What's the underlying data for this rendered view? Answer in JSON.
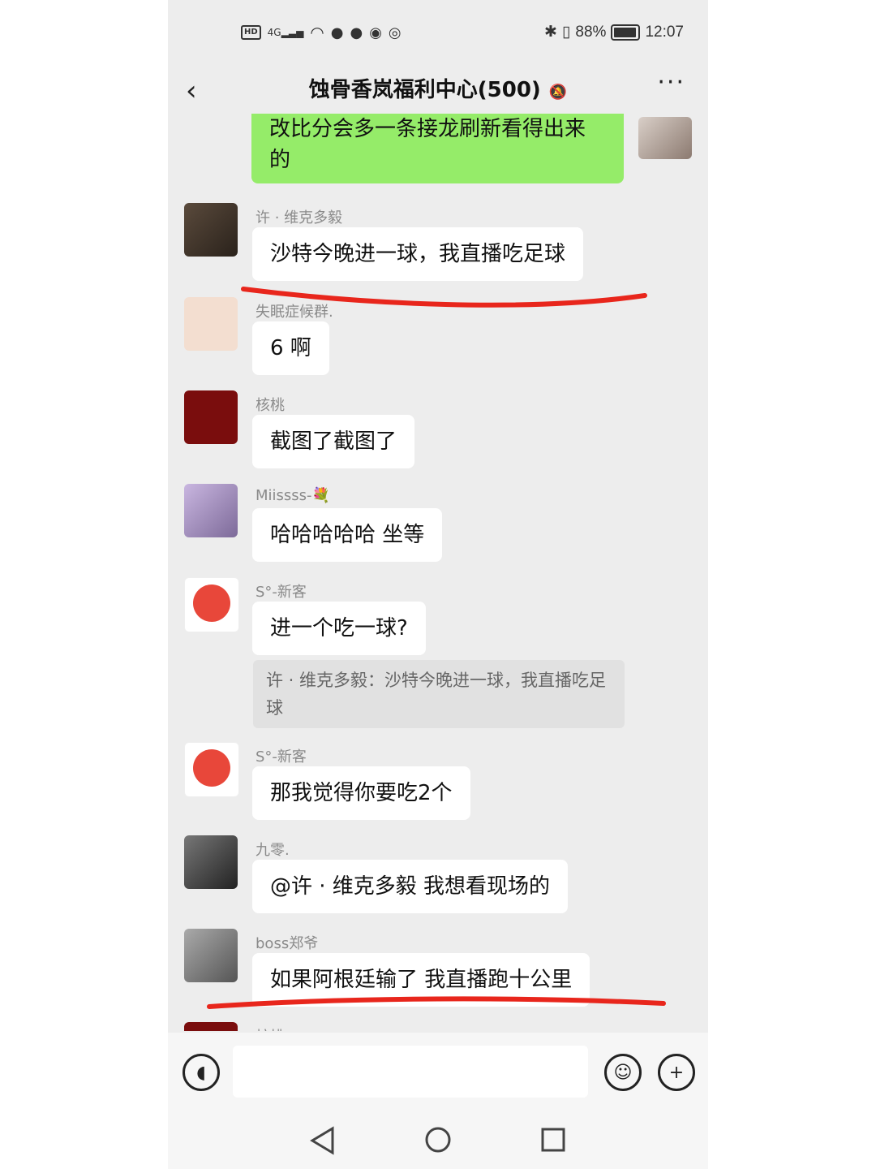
{
  "status": {
    "left_icons": [
      "hd-icon",
      "signal-icon",
      "wifi-icon",
      "chat-icon",
      "wechat-icon",
      "game-icon",
      "shield-icon"
    ],
    "hd": "HD",
    "net": "4G",
    "battery_pct": "88%",
    "time": "12:07"
  },
  "header": {
    "title": "蚀骨香岚福利中心(500)"
  },
  "messages": [
    {
      "sender": "",
      "text": "改比分会多一条接龙刷新看得出来的",
      "from_me": true
    },
    {
      "sender": "许 · 维克多毅",
      "text": "沙特今晚进一球，我直播吃足球"
    },
    {
      "sender": "失眠症候群.",
      "text": "6 啊"
    },
    {
      "sender": "核桃",
      "text": "截图了截图了"
    },
    {
      "sender": "Miissss-💐",
      "text": "哈哈哈哈哈 坐等"
    },
    {
      "sender": "S°-新客",
      "text": "进一个吃一球?",
      "quote": "许 · 维克多毅：沙特今晚进一球，我直播吃足球"
    },
    {
      "sender": "S°-新客",
      "text": "那我觉得你要吃2个"
    },
    {
      "sender": "九零.",
      "text": "@许 · 维克多毅  我想看现场的"
    },
    {
      "sender": "boss郑爷",
      "text": "如果阿根廷输了 我直播跑十公里"
    },
    {
      "sender": "核桃",
      "text": ""
    }
  ],
  "colors": {
    "chat_bg": "#ededed",
    "my_bubble": "#95ec69",
    "annotation": "#e8261c"
  }
}
